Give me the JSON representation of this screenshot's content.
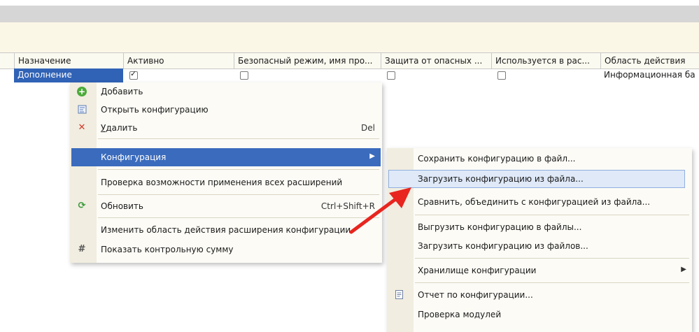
{
  "table": {
    "headers": [
      "Назначение",
      "Активно",
      "Безопасный режим, имя про...",
      "Защита от опасных ...",
      "Используется в рас...",
      "Область действия"
    ],
    "row": {
      "purpose": "Дополнение",
      "active": true,
      "safe_mode": false,
      "protection": false,
      "used": false,
      "scope": "Информационная ба"
    }
  },
  "context_menu": {
    "items": [
      {
        "label": "Добавить",
        "mnemonic": "Д",
        "rest": "обавить",
        "icon": "add-icon"
      },
      {
        "label": "Открыть конфигурацию",
        "icon": "open-config-icon"
      },
      {
        "label": "Удалить",
        "mnemonic": "У",
        "rest": "далить",
        "shortcut": "Del",
        "icon": "delete-icon"
      },
      {
        "label": "Конфигурация",
        "submenu": true
      },
      {
        "label": "Проверка возможности применения всех расширений"
      },
      {
        "label": "Обновить",
        "shortcut": "Ctrl+Shift+R",
        "icon": "refresh-icon"
      },
      {
        "label": "Изменить область действия расширения конфигурации"
      },
      {
        "label": "Показать контрольную сумму",
        "icon": "checksum-icon"
      }
    ]
  },
  "submenu": {
    "items": [
      {
        "label": "Сохранить конфигурацию в файл..."
      },
      {
        "label": "Загрузить конфигурацию из файла..."
      },
      {
        "label": "Сравнить, объединить с конфигурацией из файла..."
      },
      {
        "label": "Выгрузить конфигурацию в файлы..."
      },
      {
        "label": "Загрузить конфигурацию из файлов..."
      },
      {
        "label": "Хранилище конфигурации",
        "submenu": true
      },
      {
        "label": "Отчет по конфигурации...",
        "icon": "report-icon"
      },
      {
        "label": "Проверка модулей"
      }
    ]
  },
  "colors": {
    "selection": "#3062b6",
    "hover": "#dfe9f8",
    "arrow": "#e8251f"
  }
}
